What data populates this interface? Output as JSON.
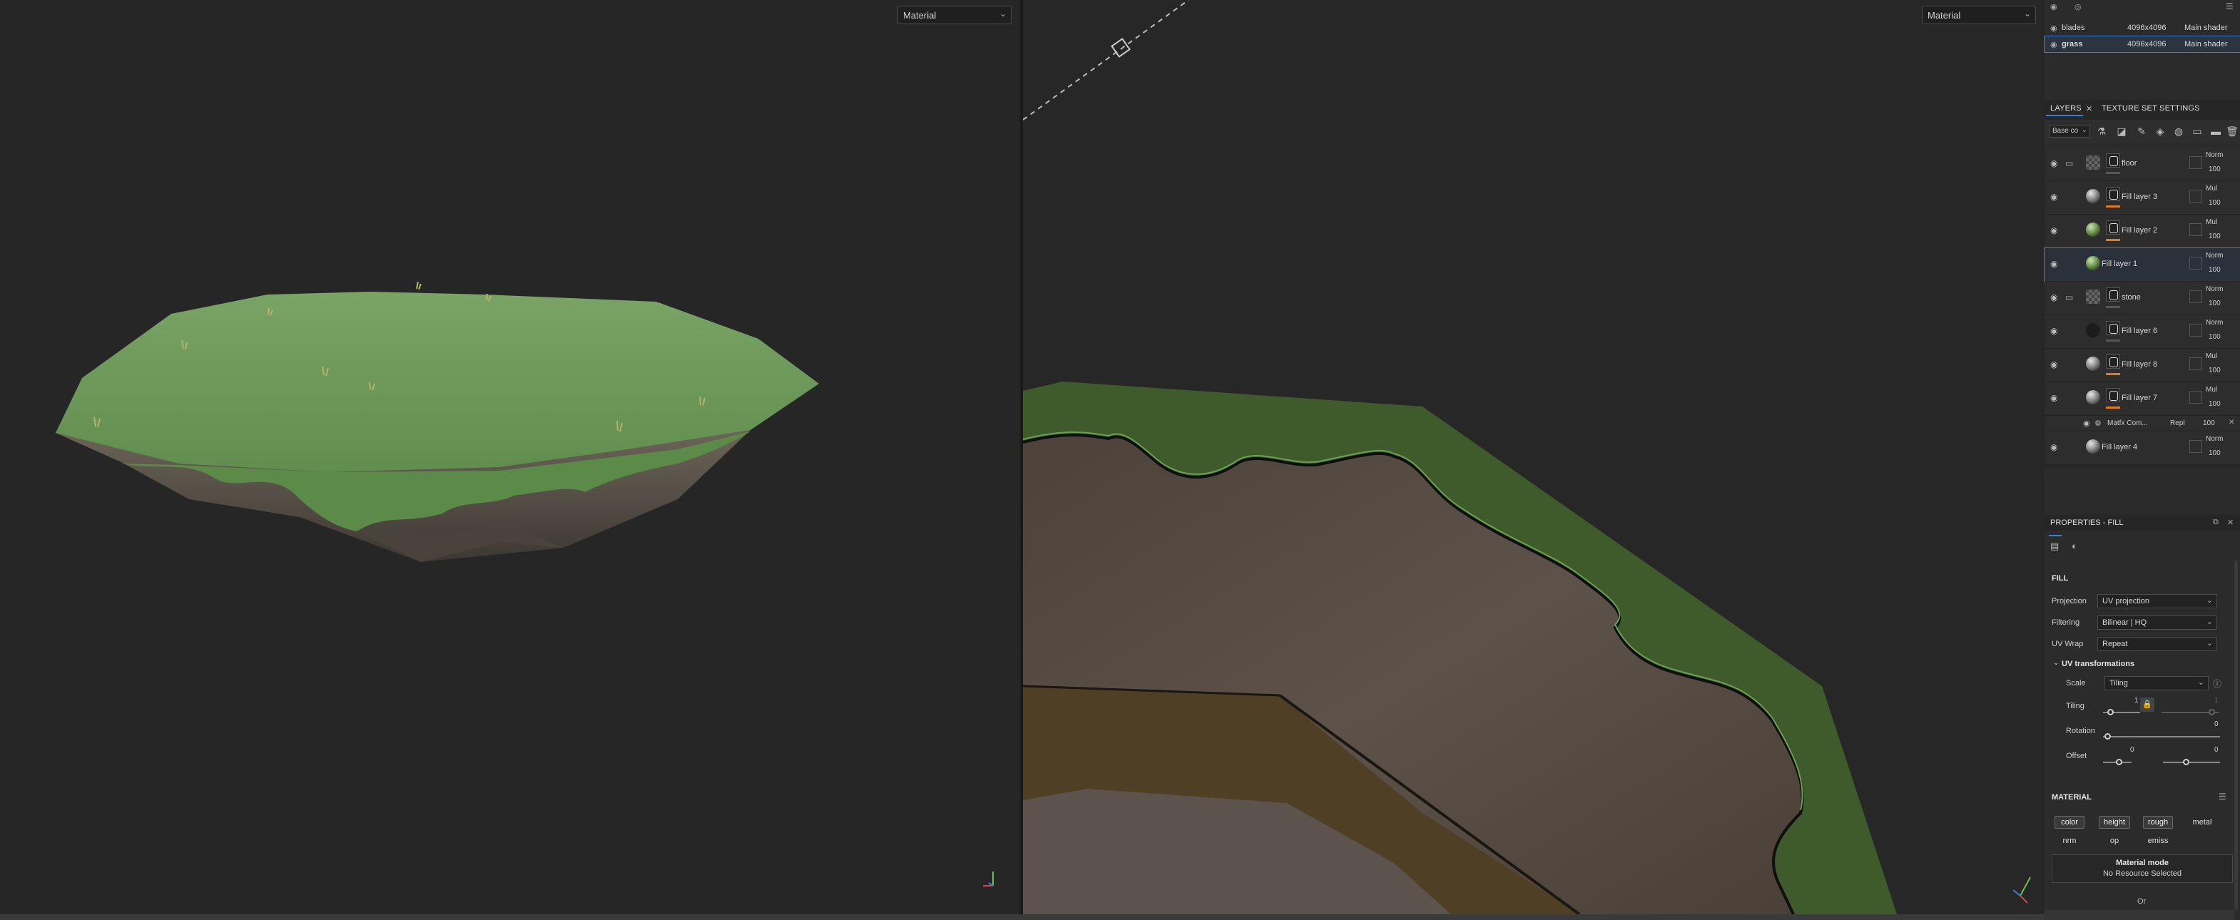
{
  "viewport_left": {
    "mode": "Material"
  },
  "viewport_right": {
    "mode": "Material"
  },
  "texture_sets": [
    {
      "name": "blades",
      "resolution": "4096x4096",
      "shader": "Main shader",
      "selected": false
    },
    {
      "name": "grass",
      "resolution": "4096x4096",
      "shader": "Main shader",
      "selected": true
    }
  ],
  "layers_panel": {
    "tabs": [
      "LAYERS",
      "TEXTURE SET SETTINGS"
    ],
    "channel": "Base co",
    "layers": [
      {
        "name": "floor",
        "type": "folder",
        "blend": "Norm",
        "opacity": "100",
        "thumb": "check",
        "bar": "gray"
      },
      {
        "name": "Fill layer 3",
        "type": "fill",
        "blend": "Mul",
        "opacity": "100",
        "thumb": "sphere",
        "bar": "orange"
      },
      {
        "name": "Fill layer 2",
        "type": "fill",
        "blend": "Mul",
        "opacity": "100",
        "thumb": "green",
        "bar": "orange"
      },
      {
        "name": "Fill layer 1",
        "type": "fill",
        "blend": "Norm",
        "opacity": "100",
        "thumb": "green",
        "bar": "none",
        "selected": true
      },
      {
        "name": "stone",
        "type": "folder",
        "blend": "Norm",
        "opacity": "100",
        "thumb": "check",
        "bar": "gray"
      },
      {
        "name": "Fill layer 6",
        "type": "fill",
        "blend": "Norm",
        "opacity": "100",
        "thumb": "dark",
        "bar": "gray"
      },
      {
        "name": "Fill layer 8",
        "type": "fill",
        "blend": "Mul",
        "opacity": "100",
        "thumb": "sphere",
        "bar": "orange"
      },
      {
        "name": "Fill layer 7",
        "type": "fill",
        "blend": "Mul",
        "opacity": "100",
        "thumb": "sphere",
        "bar": "orange"
      },
      {
        "name": "Fill layer 4",
        "type": "fill",
        "blend": "Norm",
        "opacity": "100",
        "thumb": "sphere",
        "bar": "none"
      }
    ],
    "sub_effect": {
      "name": "Matfx Com...",
      "blend": "Repl",
      "opacity": "100"
    }
  },
  "properties": {
    "title": "PROPERTIES - FILL",
    "fill_title": "FILL",
    "projection_label": "Projection",
    "projection_value": "UV projection",
    "filtering_label": "Filtering",
    "filtering_value": "Bilinear | HQ",
    "uvwrap_label": "UV Wrap",
    "uvwrap_value": "Repeat",
    "uvtransform_title": "UV transformations",
    "scale_label": "Scale",
    "scale_value": "Tiling",
    "tiling_label": "Tiling",
    "tiling_value_1": "1",
    "tiling_value_2": "1",
    "rotation_label": "Rotation",
    "rotation_value": "0",
    "offset_label": "Offset",
    "offset_value_1": "0",
    "offset_value_2": "0",
    "material_title": "MATERIAL",
    "channels": [
      "color",
      "height",
      "rough",
      "metal",
      "nrm",
      "op",
      "emiss"
    ],
    "material_mode_title": "Material mode",
    "material_mode_value": "No Resource Selected",
    "or_label": "Or"
  },
  "colors": {
    "accent": "#3d7cd6",
    "mask_bar": "#e07a22",
    "grass": "#6b9a58"
  }
}
